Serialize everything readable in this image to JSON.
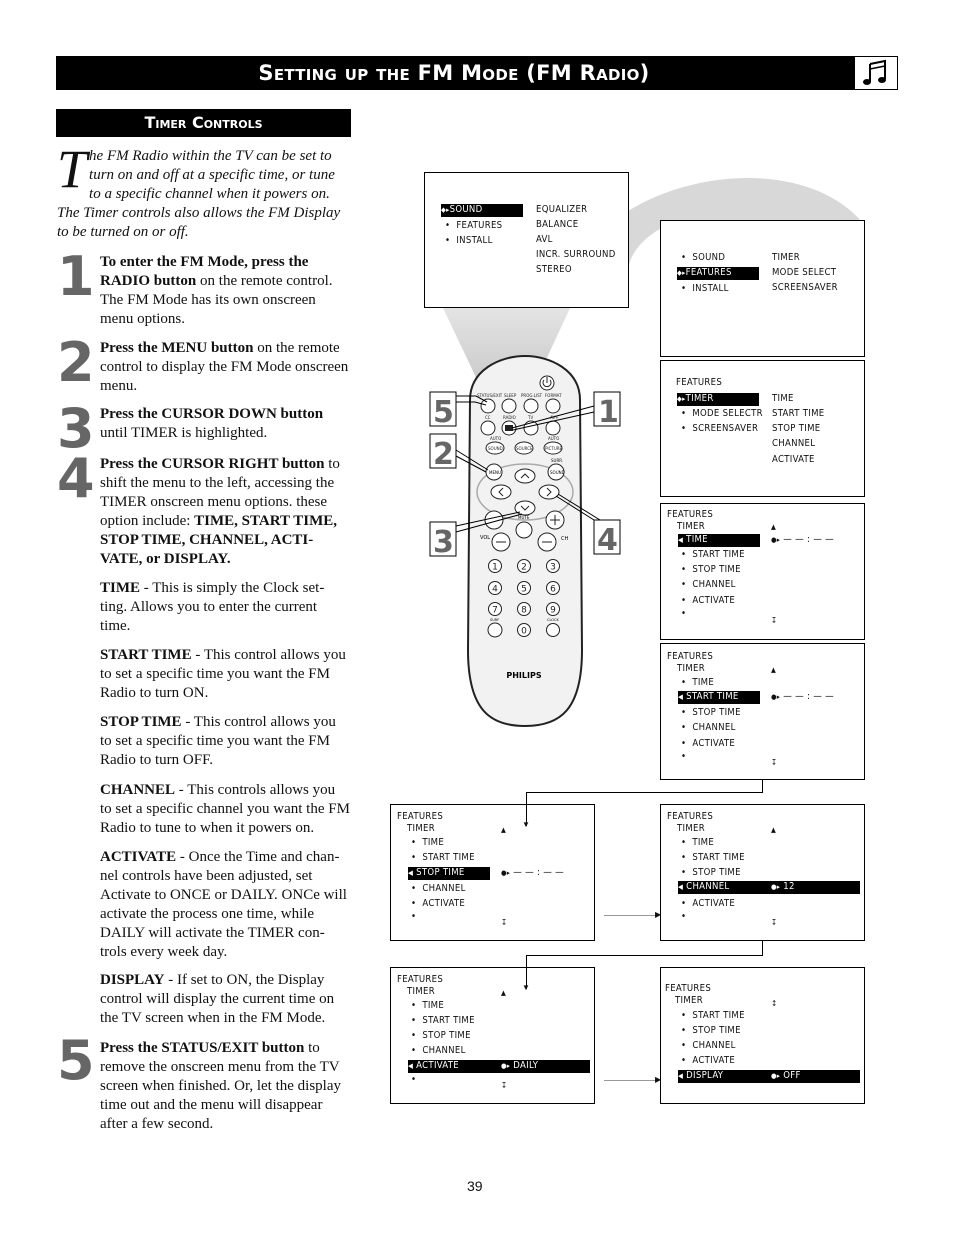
{
  "header": {
    "title": "Setting up the FM Mode (FM Radio)",
    "icon": "music-note-icon"
  },
  "section": {
    "title": "Timer Controls"
  },
  "intro": {
    "dropcap": "T",
    "text": "he FM Radio within the TV can be set to turn on and off at a specific time, or tune to a specific channel when it powers on. The Timer controls also allows the FM Display to be turned on or off."
  },
  "steps": [
    {
      "num": "1",
      "bold": "To enter the FM Mode, press the RADIO button",
      "text": " on the remote control. The FM Mode has its own onscreen menu options."
    },
    {
      "num": "2",
      "bold": "Press the MENU button",
      "text": " on the remote control to display the FM Mode onscreen menu."
    },
    {
      "num": "3",
      "bold": "Press the CURSOR DOWN button",
      "text": " until TIMER is highlighted."
    },
    {
      "num": "4",
      "bold": "Press the CURSOR RIGHT button",
      "text": " to shift the menu to the left, accessing the TIMER onscreen menu options. these option include: ",
      "bold2": "TIME, START TIME, STOP TIME, CHANNEL, ACTI-VATE, or DISPLAY."
    },
    {
      "num": "5",
      "bold": "Press the STATUS/EXIT button",
      "text": " to remove the onscreen menu from the TV screen when finished. Or, let the display time out and the menu will disappear after a few second."
    }
  ],
  "definitions": [
    {
      "term": "TIME",
      "text": " - This is simply the Clock set-ting. Allows you to enter the current time."
    },
    {
      "term": "START TIME",
      "text": " - This control allows you to set a specific time you want the FM Radio to turn ON."
    },
    {
      "term": "STOP TIME",
      "text": " - This control allows you to set a specific time you want the FM Radio to turn OFF."
    },
    {
      "term": "CHANNEL",
      "text": " - This controls allows you to set a specific channel you want the FM Radio to tune to when it powers on."
    },
    {
      "term": "ACTIVATE",
      "text": " - Once the Time and chan-nel controls have been adjusted, set Activate to ONCE or DAILY. ONCe will activate the process one time, while DAILY will activate the TIMER con-trols every week day."
    },
    {
      "term": "DISPLAY",
      "text": " - If set to ON, the Display control will display the current time on the TV screen when in the FM Mode."
    }
  ],
  "remote": {
    "brand": "PHILIPS",
    "top_labels": [
      "STATUS/EXIT",
      "SLEEP",
      "PROG.LIST",
      "FORMAT"
    ],
    "row2_labels": [
      "CC",
      "RADIO",
      "TV",
      "AV+"
    ],
    "row3_labels": [
      "SOUND",
      "SOURCE",
      "PICTURE"
    ],
    "auto_label": "AUTO",
    "menu_label": "MENU",
    "surr_label": "SURR.",
    "sound_label": "SOUND",
    "mute_label": "MUTE",
    "vol_label": "VOL",
    "ch_label": "CH",
    "digits": [
      "1",
      "2",
      "3",
      "4",
      "5",
      "6",
      "7",
      "8",
      "9",
      "0"
    ],
    "surf_label": "SURF",
    "clock_label": "CLOCK",
    "callouts": [
      "5",
      "1",
      "2",
      "4",
      "3"
    ]
  },
  "screens": {
    "s1": {
      "left": [
        {
          "label": "SOUND",
          "selected": true
        },
        {
          "label": "FEATURES"
        },
        {
          "label": "INSTALL"
        }
      ],
      "right": [
        "EQUALIZER",
        "BALANCE",
        "AVL",
        "INCR. SURROUND",
        "STEREO"
      ]
    },
    "s2": {
      "left": [
        {
          "label": "SOUND"
        },
        {
          "label": "FEATURES",
          "selected": true
        },
        {
          "label": "INSTALL"
        }
      ],
      "right": [
        "TIMER",
        "MODE SELECT",
        "SCREENSAVER"
      ]
    },
    "s3": {
      "heading": "FEATURES",
      "left": [
        {
          "label": "TIMER",
          "selected": true
        },
        {
          "label": "MODE SELECTR"
        },
        {
          "label": "SCREENSAVER"
        }
      ],
      "right": [
        "TIME",
        "START TIME",
        "STOP TIME",
        "CHANNEL",
        "ACTIVATE"
      ]
    },
    "timer_heading": "FEATURES",
    "timer_sub": "TIMER",
    "items": [
      "TIME",
      "START TIME",
      "STOP TIME",
      "CHANNEL",
      "ACTIVATE"
    ],
    "time_value": "— — : — —",
    "channel_value": "12",
    "activate_value": "DAILY",
    "display_label": "DISPLAY",
    "display_value": "OFF"
  },
  "page_number": "39"
}
